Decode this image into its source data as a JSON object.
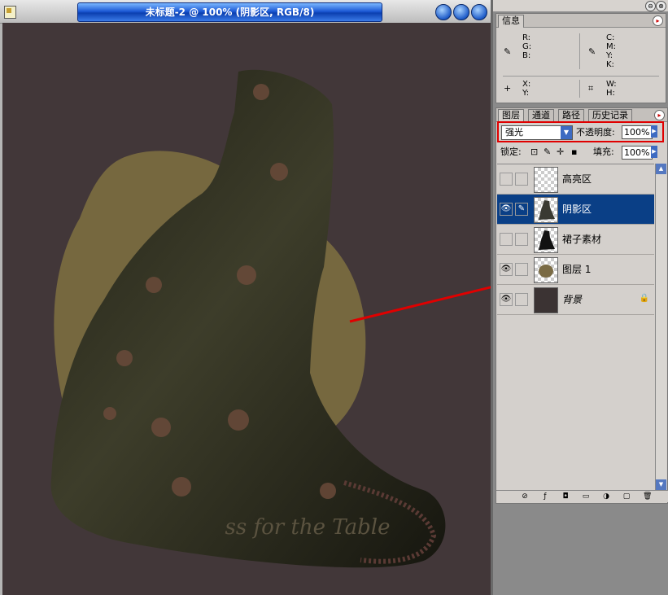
{
  "document": {
    "title": "未标题-2 @ 100% (阴影区, RGB/8)",
    "canvas_text": "ss for the Table"
  },
  "window_controls": [
    "minimize-icon",
    "maximize-icon",
    "close-icon"
  ],
  "info_palette": {
    "tab": "信息",
    "rgb_labels": [
      "R:",
      "G:",
      "B:"
    ],
    "cmyk_labels": [
      "C:",
      "M:",
      "Y:",
      "K:"
    ],
    "xy_labels": [
      "X:",
      "Y:"
    ],
    "wh_labels": [
      "W:",
      "H:"
    ]
  },
  "layers_palette": {
    "tabs": [
      "图层",
      "通道",
      "路径",
      "历史记录"
    ],
    "blend_mode": "强光",
    "opacity_label": "不透明度:",
    "opacity_value": "100%",
    "lock_label": "锁定:",
    "fill_label": "填充:",
    "fill_value": "100%",
    "layers": [
      {
        "name": "高亮区",
        "visible": false,
        "selected": false,
        "thumb": "transparent"
      },
      {
        "name": "阴影区",
        "visible": true,
        "selected": true,
        "thumb": "dress-shadow"
      },
      {
        "name": "裙子素材",
        "visible": false,
        "selected": false,
        "thumb": "dress"
      },
      {
        "name": "图层 1",
        "visible": true,
        "selected": false,
        "thumb": "blob"
      },
      {
        "name": "背景",
        "visible": true,
        "selected": false,
        "thumb": "dark",
        "locked": true
      }
    ],
    "bottom_icons": [
      "link-icon",
      "layer-style-icon",
      "mask-icon",
      "new-set-icon",
      "adjustment-icon",
      "new-layer-icon",
      "trash-icon"
    ]
  },
  "colors": {
    "canvas_bg": "#423739",
    "blob": "#7a6b45",
    "dress": "#2e2e1f",
    "selected_row": "#0a3f86",
    "annotation": "#e00000"
  }
}
